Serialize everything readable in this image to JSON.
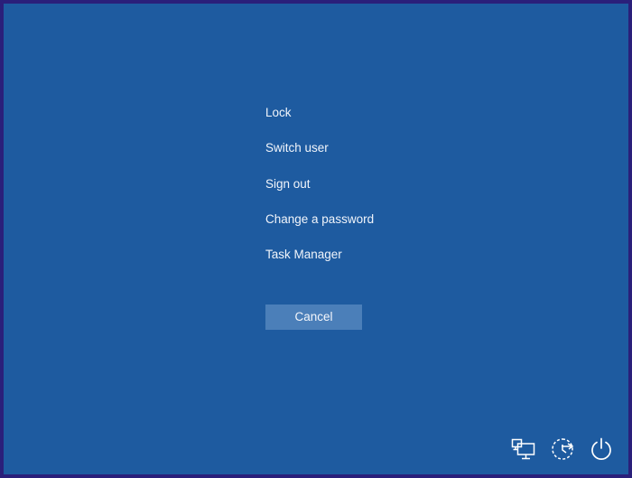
{
  "menu": {
    "items": [
      {
        "label": "Lock"
      },
      {
        "label": "Switch user"
      },
      {
        "label": "Sign out"
      },
      {
        "label": "Change a password"
      },
      {
        "label": "Task Manager"
      }
    ]
  },
  "cancel": {
    "label": "Cancel"
  },
  "tray": {
    "icons": [
      "network-icon",
      "ease-of-access-icon",
      "power-icon"
    ]
  },
  "colors": {
    "background": "#1e5ba0",
    "frame": "#2a1f7a",
    "button": "#4b7fb9",
    "text": "#f3f6fb"
  }
}
